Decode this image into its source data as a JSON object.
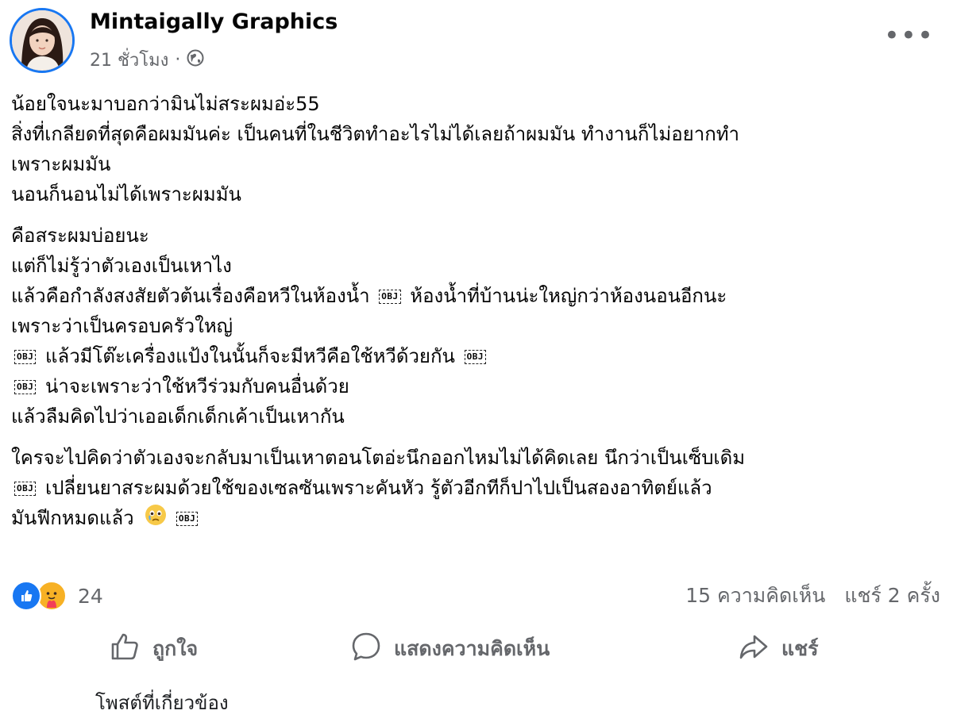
{
  "post": {
    "author": "Mintaigally Graphics",
    "time": "21 ชั่วโมง",
    "separator": "·",
    "privacy_icon": "globe-icon",
    "more_label": "•••"
  },
  "content": {
    "paragraphs": [
      {
        "lines": [
          "น้อยใจนะมาบอกว่ามินไม่สระผมอ่ะ55",
          "สิ่งที่เกลียดที่สุดคือผมมันค่ะ เป็นคนที่ในชีวิตทำอะไรไม่ได้เลยถ้าผมมัน ทำงานก็ไม่อยากทำ",
          "เพราะผมมัน",
          "นอนก็นอนไม่ได้เพราะผมมัน"
        ]
      },
      {
        "lines": [
          "คือสระผมบ่อยนะ",
          "แต่ก็ไม่รู้ว่าตัวเองเป็นเหาไง",
          "แล้วคือกำลังสงสัยตัวต้นเรื่องคือหวีในห้องน้ำ",
          "ห้องน้ำที่บ้านน่ะใหญ่กว่าห้องนอนอีกนะ",
          "เพราะว่าเป็นครอบครัวใหญ่",
          "แล้วมีโต๊ะเครื่องแป้งในนั้นก็จะมีหวีคือใช้หวีด้วยกัน",
          "น่าจะเพราะว่าใช้หวีร่วมกับคนอื่นด้วย",
          "แล้วลืมคิดไปว่าเออเด็กเด็กเค้าเป็นเหากัน"
        ]
      },
      {
        "lines": [
          "ใครจะไปคิดว่าตัวเองจะกลับมาเป็นเหาตอนโตอ่ะนึกออกไหมไม่ได้คิดเลย  นึกว่าเป็นเซ็บเดิม",
          "เปลี่ยนยาสระผมด้วยใช้ของเซลซันเพราะคันหัว รู้ตัวอีกทีก็ปาไปเป็นสองอาทิตย์แล้ว",
          "มันฟีกหมดแล้ว"
        ]
      }
    ],
    "obj_label": "OBJ"
  },
  "stats": {
    "reaction_count": "24",
    "comments": "15 ความคิดเห็น",
    "shares": "แชร์ 2 ครั้ง"
  },
  "actions": {
    "like": "ถูกใจ",
    "comment": "แสดงความคิดเห็น",
    "share": "แชร์"
  },
  "footer_cut": "โพสต์ที่เกี่ยวข้อง"
}
